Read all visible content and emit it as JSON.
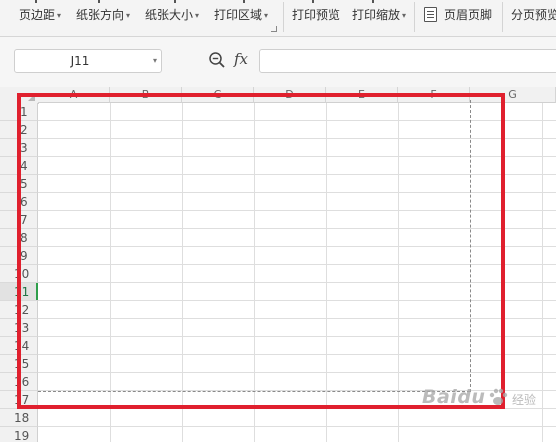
{
  "ribbon": {
    "items": [
      {
        "label": "页边距",
        "has_dropdown": true
      },
      {
        "label": "纸张方向",
        "has_dropdown": true
      },
      {
        "label": "纸张大小",
        "has_dropdown": true
      },
      {
        "label": "打印区域",
        "has_dropdown": true
      },
      {
        "label": "打印预览",
        "has_dropdown": false
      },
      {
        "label": "打印缩放",
        "has_dropdown": true
      },
      {
        "label": "页眉页脚",
        "has_dropdown": false,
        "icon": "page-header-icon"
      },
      {
        "label": "分页预览",
        "has_dropdown": false
      }
    ],
    "dropdown_glyph": "▾"
  },
  "formula_bar": {
    "cell_reference": "J11",
    "dropdown_glyph": "▾",
    "zoom_icon": "zoom-icon",
    "fx_label": "fx",
    "formula_value": ""
  },
  "sheet": {
    "columns": [
      "A",
      "B",
      "C",
      "D",
      "E",
      "F",
      "G"
    ],
    "rows": [
      "1",
      "2",
      "3",
      "4",
      "5",
      "6",
      "7",
      "8",
      "9",
      "10",
      "11",
      "12",
      "13",
      "14",
      "15",
      "16",
      "17",
      "18",
      "19"
    ],
    "active_row": "11",
    "print_area_highlight_color": "#e0202e",
    "active_color": "#2e9e4a"
  },
  "watermark": {
    "main": "Baidu",
    "sub": "经验"
  }
}
